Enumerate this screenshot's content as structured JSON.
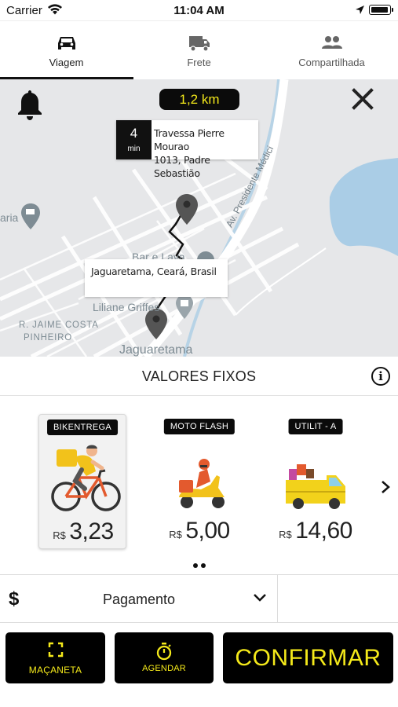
{
  "status_bar": {
    "carrier": "Carrier",
    "time": "11:04 AM"
  },
  "tabs": [
    {
      "label": "Viagem",
      "icon": "car-icon",
      "active": true
    },
    {
      "label": "Frete",
      "icon": "truck-icon",
      "active": false
    },
    {
      "label": "Compartilhada",
      "icon": "people-icon",
      "active": false
    }
  ],
  "map": {
    "distance": "1,2 km",
    "eta": {
      "value": "4",
      "unit": "min"
    },
    "origin_address": [
      "Travessa Pierre Mourao",
      "1013, Padre Sebastião"
    ],
    "destination_address": "Jaguaretama, Ceará, Brasil",
    "labels": {
      "avenue": "Av. Presidente Médici",
      "street": "R. JAIME COSTA",
      "district": "PINHEIRO",
      "shop1": "Liliane Griffes",
      "shop2": "Bar e Lava",
      "city": "Jaguaretama",
      "left_poi": "aria"
    }
  },
  "fixed_values": {
    "title": "VALORES FIXOS"
  },
  "vehicles": [
    {
      "name": "BIKENTREGA",
      "currency": "R$",
      "price": "3,23",
      "icon": "bicycle-courier-icon",
      "selected": true
    },
    {
      "name": "MOTO FLASH",
      "currency": "R$",
      "price": "5,00",
      "icon": "motorcycle-courier-icon",
      "selected": false
    },
    {
      "name": "UTILIT - A",
      "currency": "R$",
      "price": "14,60",
      "icon": "van-icon",
      "selected": false
    }
  ],
  "payment": {
    "symbol": "$",
    "label": "Pagamento"
  },
  "actions": {
    "handle_label": "MAÇANETA",
    "schedule_label": "AGENDAR",
    "confirm_label": "CONFIRMAR"
  },
  "colors": {
    "accent": "#f4e91a",
    "dark": "#0b0b0b"
  }
}
